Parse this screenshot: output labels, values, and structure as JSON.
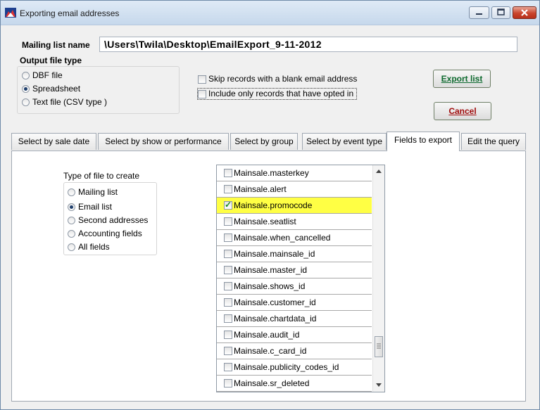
{
  "window": {
    "title": "Exporting email addresses"
  },
  "mailing_list": {
    "label": "Mailing list name",
    "value": "\\Users\\Twila\\Desktop\\EmailExport_9-11-2012"
  },
  "output_type": {
    "label": "Output file type",
    "options": [
      "DBF file",
      "Spreadsheet",
      "Text file (CSV type )"
    ],
    "selected": "Spreadsheet"
  },
  "checks": {
    "skip_blank": "Skip records with a blank email address",
    "opted_in": "Include only records that have opted in"
  },
  "buttons": {
    "export": "Export list",
    "cancel": "Cancel"
  },
  "tabs": [
    "Select by sale date",
    "Select by show or performance",
    "Select by group",
    "Select by event type",
    "Fields to export",
    "Edit the query"
  ],
  "active_tab": "Fields to export",
  "type_of_file": {
    "label": "Type of file to create",
    "options": [
      "Mailing list",
      "Email list",
      "Second addresses",
      "Accounting fields",
      "All fields"
    ],
    "selected": "Email list"
  },
  "fields": [
    {
      "name": "Mainsale.masterkey",
      "checked": false
    },
    {
      "name": "Mainsale.alert",
      "checked": false
    },
    {
      "name": "Mainsale.promocode",
      "checked": true
    },
    {
      "name": "Mainsale.seatlist",
      "checked": false
    },
    {
      "name": "Mainsale.when_cancelled",
      "checked": false
    },
    {
      "name": "Mainsale.mainsale_id",
      "checked": false
    },
    {
      "name": "Mainsale.master_id",
      "checked": false
    },
    {
      "name": "Mainsale.shows_id",
      "checked": false
    },
    {
      "name": "Mainsale.customer_id",
      "checked": false
    },
    {
      "name": "Mainsale.chartdata_id",
      "checked": false
    },
    {
      "name": "Mainsale.audit_id",
      "checked": false
    },
    {
      "name": "Mainsale.c_card_id",
      "checked": false
    },
    {
      "name": "Mainsale.publicity_codes_id",
      "checked": false
    },
    {
      "name": "Mainsale.sr_deleted",
      "checked": false
    }
  ],
  "colors": {
    "highlight": "#ffff44",
    "export_text": "#0d6a2e",
    "cancel_text": "#a00b0b"
  }
}
